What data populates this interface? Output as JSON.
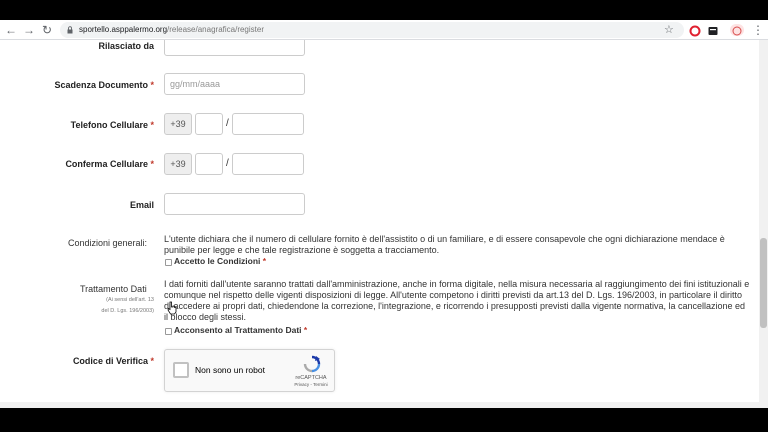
{
  "browser": {
    "url_host": "sportello.asppalermo.org",
    "url_path": "/release/anagrafica/register"
  },
  "form": {
    "rilasciato_label": "Rilasciato da",
    "scadenza_label": "Scadenza Documento",
    "scadenza_placeholder": "gg/mm/aaaa",
    "telefono_label": "Telefono Cellulare",
    "conferma_label": "Conferma Cellulare",
    "prefix": "+39",
    "slash": "/",
    "email_label": "Email",
    "required_mark": "*",
    "condizioni_label": "Condizioni generali:",
    "condizioni_text": "L'utente dichiara che il numero di cellulare fornito è dell'assistito o di un familiare, e di essere consapevole che ogni dichiarazione mendace è punibile per legge e che tale registrazione è soggetta a tracciamento.",
    "accetto_label": "Accetto le Condizioni",
    "trattamento_label": "Trattamento Dati",
    "trattamento_sub1": "(Ai sensi dell'art. 13",
    "trattamento_sub2": "del D. Lgs. 196/2003)",
    "trattamento_text": "I dati forniti dall'utente saranno trattati dall'amministrazione, anche in forma digitale, nella misura necessaria al raggiungimento dei fini istituzionali e comunque nel rispetto delle vigenti disposizioni di legge. All'utente competono i diritti previsti da art.13 del D. Lgs. 196/2003, in particolare il diritto di accedere ai propri dati, chiedendone la correzione, l'integrazione, e ricorrendo i presupposti previsti dalla vigente normativa, la cancellazione ed il blocco degli stessi.",
    "acconsento_label": "Acconsento al Trattamento Dati",
    "codice_label": "Codice di Verifica"
  },
  "recaptcha": {
    "checkbox_label": "Non sono un robot",
    "brand": "reCAPTCHA",
    "links": "Privacy - Termini"
  },
  "colors": {
    "required": "#c0392b",
    "recaptcha_blue": "#4a90e2"
  }
}
